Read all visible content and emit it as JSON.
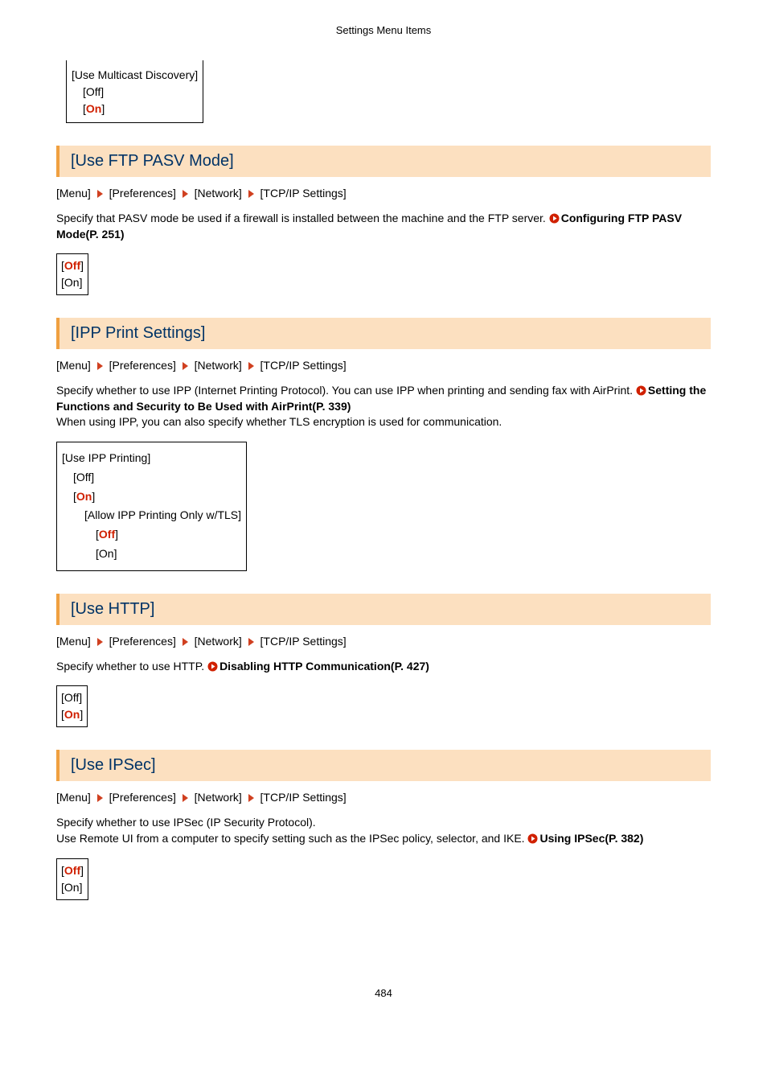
{
  "pageHeader": "Settings Menu Items",
  "pageNumber": "484",
  "topBox": {
    "label": "[Use Multicast Discovery]",
    "off": "[Off]",
    "onBracketOpen": "[",
    "onText": "On",
    "onBracketClose": "]"
  },
  "breadcrumbParts": {
    "p1": "[Menu]",
    "p2": "[Preferences]",
    "p3": "[Network]",
    "p4": "[TCP/IP Settings]"
  },
  "sections": {
    "ftp": {
      "title": "[Use FTP PASV Mode]",
      "desc1": "Specify that PASV mode be used if a firewall is installed between the machine and the FTP server. ",
      "xref": "Configuring FTP PASV Mode(P. 251)",
      "opts": {
        "offOpen": "[",
        "offText": "Off",
        "offClose": "]",
        "on": "[On]"
      }
    },
    "ipp": {
      "title": "[IPP Print Settings]",
      "desc1": "Specify whether to use IPP (Internet Printing Protocol). You can use IPP when printing and sending fax with AirPrint. ",
      "xref": "Setting the Functions and Security to Be Used with AirPrint(P. 339)",
      "desc2": "When using IPP, you can also specify whether TLS encryption is used for communication.",
      "opts": {
        "l1": "[Use IPP Printing]",
        "l2off": "[Off]",
        "l2onOpen": "[",
        "l2onText": "On",
        "l2onClose": "]",
        "l3": "[Allow IPP Printing Only w/TLS]",
        "l4offOpen": "[",
        "l4offText": "Off",
        "l4offClose": "]",
        "l4on": "[On]"
      }
    },
    "http": {
      "title": "[Use HTTP]",
      "desc1": "Specify whether to use HTTP. ",
      "xref": "Disabling HTTP Communication(P. 427)",
      "opts": {
        "off": "[Off]",
        "onOpen": "[",
        "onText": "On",
        "onClose": "]"
      }
    },
    "ipsec": {
      "title": "[Use IPSec]",
      "desc1": "Specify whether to use IPSec (IP Security Protocol).",
      "desc2": "Use Remote UI from a computer to specify setting such as the IPSec policy, selector, and IKE. ",
      "xref": "Using IPSec(P. 382)",
      "opts": {
        "offOpen": "[",
        "offText": "Off",
        "offClose": "]",
        "on": "[On]"
      }
    }
  }
}
